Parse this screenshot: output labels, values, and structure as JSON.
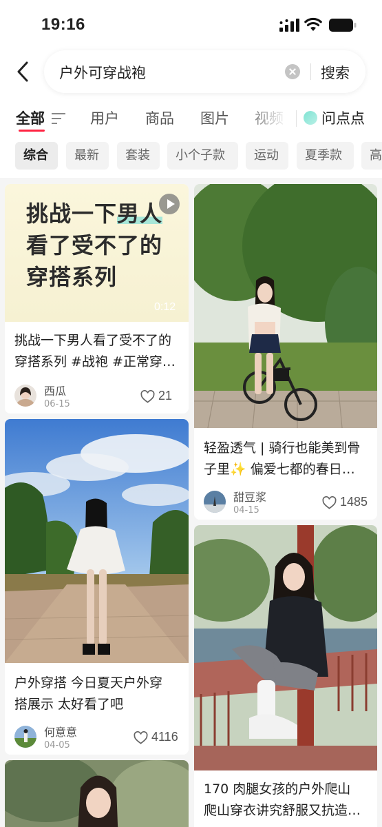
{
  "status_bar": {
    "time": "19:16"
  },
  "search": {
    "query": "户外可穿战袍",
    "submit_label": "搜索"
  },
  "tabs": [
    {
      "label": "全部"
    },
    {
      "label": "用户"
    },
    {
      "label": "商品"
    },
    {
      "label": "图片"
    },
    {
      "label": "视频"
    },
    {
      "label": "问点点"
    }
  ],
  "chips": [
    {
      "label": "综合"
    },
    {
      "label": "最新"
    },
    {
      "label": "套装"
    },
    {
      "label": "小个子款"
    },
    {
      "label": "运动"
    },
    {
      "label": "夏季款"
    },
    {
      "label": "高"
    }
  ],
  "feed": {
    "left": [
      {
        "cover_lines": [
          "挑战一下",
          "男人",
          "看了受不了的",
          "穿搭系列"
        ],
        "duration": "0:12",
        "title_lines": [
          "挑战一下男人看了受不了的",
          "穿搭系列 #战袍 #正常穿…"
        ],
        "author": "西瓜",
        "date": "06-15",
        "likes": "21"
      },
      {
        "title_lines": [
          "户外穿搭 今日夏天户外穿",
          "搭展示 太好看了吧"
        ],
        "author": "何意意",
        "date": "04-05",
        "likes": "4116"
      }
    ],
    "right": [
      {
        "title_lines": [
          "轻盈透气 | 骑行也能美到骨",
          "子里✨ 偏爱七都的春日…"
        ],
        "author": "甜豆浆",
        "date": "04-15",
        "likes": "1485"
      },
      {
        "title_lines": [
          "170 肉腿女孩的户外爬山",
          "爬山穿衣讲究舒服又抗造…"
        ]
      }
    ]
  },
  "colors": {
    "accent": "#ff2442",
    "highlight": "#a7e6d8"
  }
}
